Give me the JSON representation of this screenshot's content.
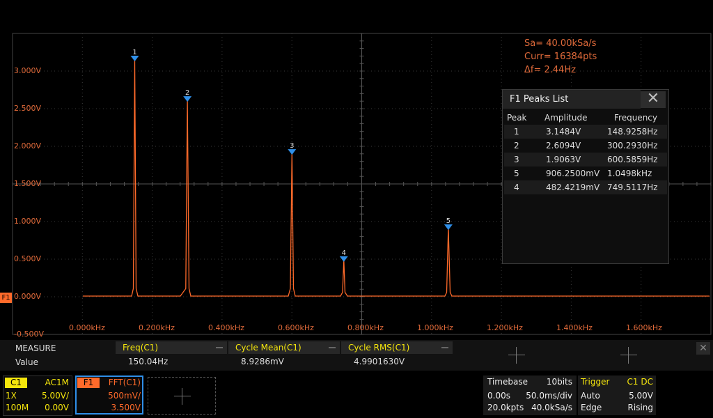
{
  "acquisition": {
    "sample_rate": "Sa=  40.00kSa/s",
    "current_points": "Curr= 16384pts",
    "delta_f": "Δf=  2.44Hz"
  },
  "trace_label": "F1",
  "chart_data": {
    "type": "line",
    "series": [
      {
        "name": "FFT(C1)",
        "color": "#ff6a2a"
      }
    ],
    "x": [
      0,
      0.1,
      0.14,
      0.145,
      0.149,
      0.153,
      0.158,
      0.2,
      0.28,
      0.2955,
      0.3003,
      0.305,
      0.31,
      0.4,
      0.59,
      0.596,
      0.6006,
      0.605,
      0.61,
      0.7,
      0.74,
      0.746,
      0.7495,
      0.753,
      0.76,
      0.9,
      1.04,
      1.045,
      1.0498,
      1.055,
      1.06,
      1.2,
      1.4,
      1.6,
      1.8
    ],
    "y": [
      0,
      0,
      0,
      0.1,
      3.1484,
      0.1,
      0,
      0,
      0,
      0.1,
      2.6094,
      0.1,
      0,
      0,
      0,
      0.1,
      1.9063,
      0.1,
      0,
      0,
      0,
      0.05,
      0.4824,
      0.05,
      0,
      0,
      0,
      0.05,
      0.9063,
      0.05,
      0,
      0,
      0,
      0,
      0
    ],
    "x_unit": "kHz",
    "xlim": [
      0,
      1.8
    ],
    "ylim": [
      -0.5,
      3.5
    ],
    "x_ticks": [
      "0.000kHz",
      "0.200kHz",
      "0.400kHz",
      "0.600kHz",
      "0.800kHz",
      "1.000kHz",
      "1.200kHz",
      "1.400kHz",
      "1.600kHz"
    ],
    "y_ticks": [
      "3.000V",
      "2.500V",
      "2.000V",
      "1.500V",
      "1.000V",
      "0.500V",
      "0.000V",
      "-0.500V"
    ],
    "y_tick_values": [
      3.0,
      2.5,
      2.0,
      1.5,
      1.0,
      0.5,
      0.0,
      -0.5
    ],
    "markers": [
      {
        "label": "1",
        "x": 0.149,
        "y": 3.1484
      },
      {
        "label": "2",
        "x": 0.3003,
        "y": 2.6094
      },
      {
        "label": "3",
        "x": 0.6006,
        "y": 1.9063
      },
      {
        "label": "4",
        "x": 0.7495,
        "y": 0.4824
      },
      {
        "label": "5",
        "x": 1.0498,
        "y": 0.9063
      }
    ],
    "grid": true
  },
  "peaks_panel": {
    "title": "F1 Peaks List",
    "close_glyph": "✕",
    "headers": [
      "Peak",
      "Amplitude",
      "Frequency"
    ],
    "rows": [
      {
        "peak": "1",
        "amplitude": "3.1484V",
        "frequency": "148.9258Hz"
      },
      {
        "peak": "2",
        "amplitude": "2.6094V",
        "frequency": "300.2930Hz"
      },
      {
        "peak": "3",
        "amplitude": "1.9063V",
        "frequency": "600.5859Hz"
      },
      {
        "peak": "5",
        "amplitude": "906.2500mV",
        "frequency": "1.0498kHz"
      },
      {
        "peak": "4",
        "amplitude": "482.4219mV",
        "frequency": "749.5117Hz"
      }
    ]
  },
  "measure": {
    "title": "MEASURE",
    "row_label": "Value",
    "items": [
      {
        "name": "Freq(C1)",
        "value": "150.04Hz"
      },
      {
        "name": "Cycle Mean(C1)",
        "value": "8.9286mV"
      },
      {
        "name": "Cycle RMS(C1)",
        "value": "4.9901630V"
      }
    ]
  },
  "channels": {
    "c1": {
      "name": "C1",
      "coupling": "AC1M",
      "probe": "1X",
      "scale": "5.00V/",
      "bandwidth": "100M",
      "offset": "0.00V"
    },
    "f1": {
      "name": "F1",
      "source": "FFT(C1)",
      "scale": "500mV/",
      "offset": "3.500V"
    }
  },
  "timebase": {
    "title": "Timebase",
    "bits": "10bits",
    "delay": "0.00s",
    "scale": "50.0ms/div",
    "points": "20.0kpts",
    "rate": "40.0kSa/s"
  },
  "trigger": {
    "title": "Trigger",
    "source": "C1 DC",
    "mode": "Auto",
    "level": "5.00V",
    "type": "Edge",
    "slope": "Rising"
  },
  "colors": {
    "trace": "#ff6a2a",
    "c1": "#f5e60c",
    "f1": "#ff6a2a",
    "marker": "#2f8fe8",
    "grid": "#3a3a3a"
  }
}
